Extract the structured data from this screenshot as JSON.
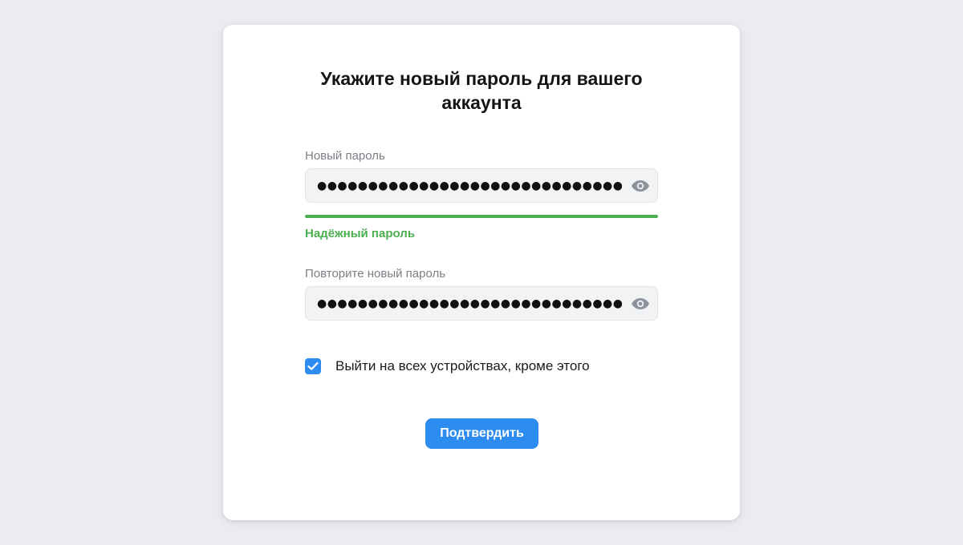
{
  "form": {
    "title": "Укажите новый пароль для вашего аккаунта",
    "new_password": {
      "label": "Новый пароль",
      "value": "●●●●●●●●●●●●●●●●●●●●●●●●●●●●●●●●●●●",
      "toggle_icon": "eye-icon"
    },
    "strength": {
      "level": 1.0,
      "text": "Надёжный пароль",
      "color": "#4caf50"
    },
    "repeat_password": {
      "label": "Повторите новый пароль",
      "value": "●●●●●●●●●●●●●●●●●●●●●●●●●●●●●●●●●●●",
      "toggle_icon": "eye-icon"
    },
    "logout_other_devices": {
      "checked": true,
      "label": "Выйти на всех устройствах, кроме этого"
    },
    "submit_label": "Подтвердить"
  },
  "colors": {
    "accent": "#2d8cf0",
    "success": "#4caf50",
    "background": "#ebebf0"
  }
}
